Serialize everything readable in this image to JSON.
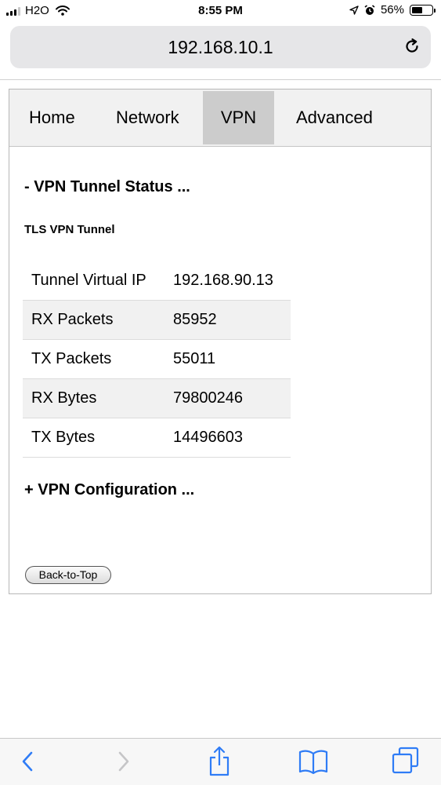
{
  "status_bar": {
    "carrier": "H2O",
    "time": "8:55 PM",
    "battery_percent": "56%",
    "battery_level": 0.56,
    "icons": [
      "signal-icon",
      "wifi-icon",
      "location-arrow-icon",
      "alarm-icon",
      "battery-icon"
    ]
  },
  "address_bar": {
    "url": "192.168.10.1",
    "reload_icon": "reload-icon"
  },
  "nav": {
    "tabs": [
      {
        "label": "Home"
      },
      {
        "label": "Network"
      },
      {
        "label": "VPN",
        "active": true
      },
      {
        "label": "Advanced"
      }
    ]
  },
  "vpn_status": {
    "title": "- VPN Tunnel Status ...",
    "subtitle": "TLS VPN Tunnel",
    "rows": [
      {
        "label": "Tunnel Virtual IP",
        "value": "192.168.90.13"
      },
      {
        "label": "RX Packets",
        "value": "85952"
      },
      {
        "label": "TX Packets",
        "value": "55011"
      },
      {
        "label": "RX Bytes",
        "value": "79800246"
      },
      {
        "label": "TX Bytes",
        "value": "14496603"
      }
    ]
  },
  "vpn_config": {
    "title": "+ VPN Configuration ..."
  },
  "back_to_top": {
    "label": "Back-to-Top"
  },
  "toolbar": {
    "icons": [
      "back-icon",
      "forward-icon",
      "share-icon",
      "bookmarks-icon",
      "tabs-icon"
    ]
  },
  "colors": {
    "active_tab_bg": "#cccccc",
    "nav_bg": "#f1f1f1",
    "address_bar_bg": "#e6e6e8",
    "toolbar_icon": "#2f7cf6"
  }
}
